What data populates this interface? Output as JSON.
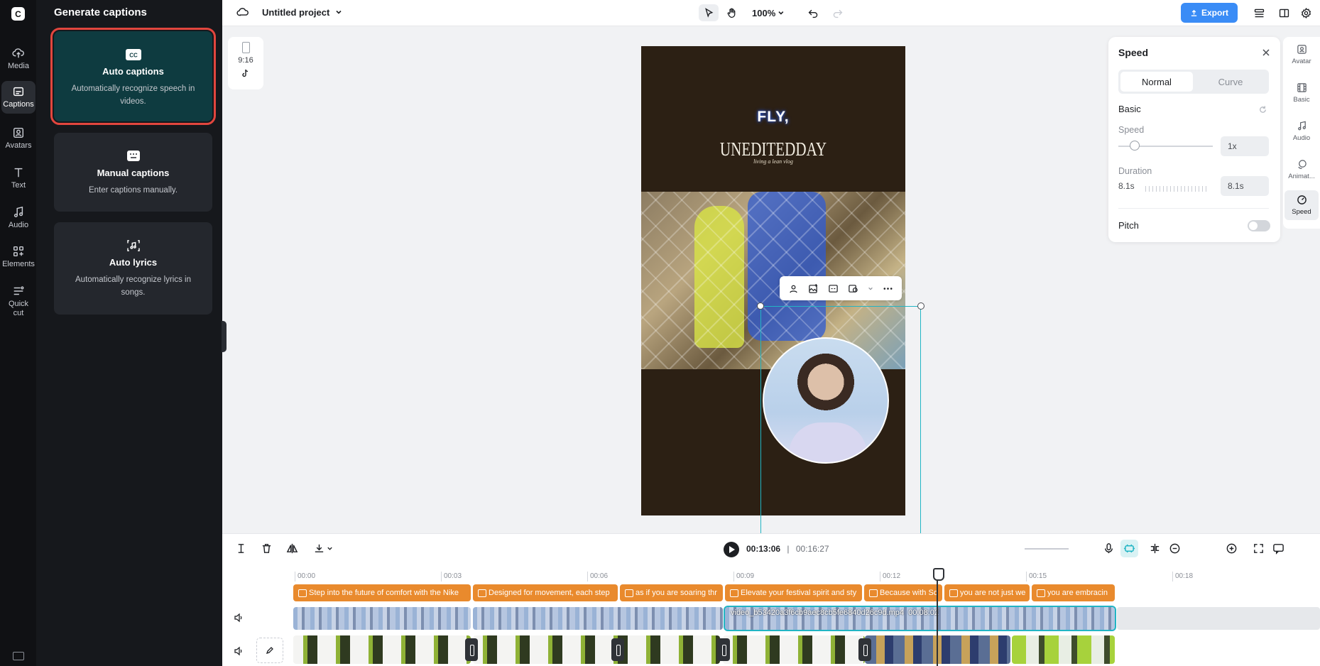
{
  "rail": {
    "items": [
      {
        "label": "Media",
        "icon": "cloud-upload-icon"
      },
      {
        "label": "Captions",
        "icon": "captions-icon"
      },
      {
        "label": "Avatars",
        "icon": "avatar-icon"
      },
      {
        "label": "Text",
        "icon": "text-icon"
      },
      {
        "label": "Audio",
        "icon": "music-note-icon"
      },
      {
        "label": "Elements",
        "icon": "grid-icon"
      },
      {
        "label": "Quick cut",
        "icon": "quick-cut-icon"
      }
    ],
    "active": "Captions"
  },
  "panel": {
    "title": "Generate captions",
    "cards": [
      {
        "title": "Auto captions",
        "desc": "Automatically recognize speech in videos.",
        "icon": "cc-icon"
      },
      {
        "title": "Manual captions",
        "desc": "Enter captions manually.",
        "icon": "keyboard-icon"
      },
      {
        "title": "Auto lyrics",
        "desc": "Automatically recognize lyrics in songs.",
        "icon": "lyrics-icon"
      }
    ]
  },
  "topbar": {
    "project": "Untitled project",
    "zoom": "100%",
    "export": "Export"
  },
  "ratio": {
    "label": "9:16"
  },
  "video": {
    "caption": "FLY,",
    "brand": "UNEDITEDDAY",
    "tagline": "living a lean vlog"
  },
  "speed_panel": {
    "title": "Speed",
    "tabs": [
      "Normal",
      "Curve"
    ],
    "section": "Basic",
    "speed_label": "Speed",
    "speed_value": "1x",
    "speed_level": 0.17,
    "duration_label": "Duration",
    "duration_left": "8.1s",
    "duration_value": "8.1s",
    "pitch_label": "Pitch"
  },
  "right_tabs": [
    "Avatar",
    "Basic",
    "Audio",
    "Animat...",
    "Speed"
  ],
  "timeline": {
    "current": "00:13:06",
    "total": "00:16:27",
    "ticks": [
      "00:00",
      "00:03",
      "00:06",
      "00:09",
      "00:12",
      "00:15",
      "00:18"
    ],
    "captions": [
      "Step into the future of comfort with the Nike",
      "Designed for movement, each step",
      "as if you are soaring thr",
      "Elevate your festival spirit and sty",
      "Because with So",
      "you are not just we",
      "you are embracin"
    ],
    "avatar_clip": "video_b53420a3f6cb9aec8cb5fe6840d26c9d.mp4",
    "avatar_clip_time": "00:08:02"
  },
  "colors": {
    "accent": "#3a8cf6",
    "caption_clip": "#e98a2d",
    "selection": "#22b5c4",
    "selected_card": "#0e3b40",
    "highlight": "#e2463e"
  }
}
